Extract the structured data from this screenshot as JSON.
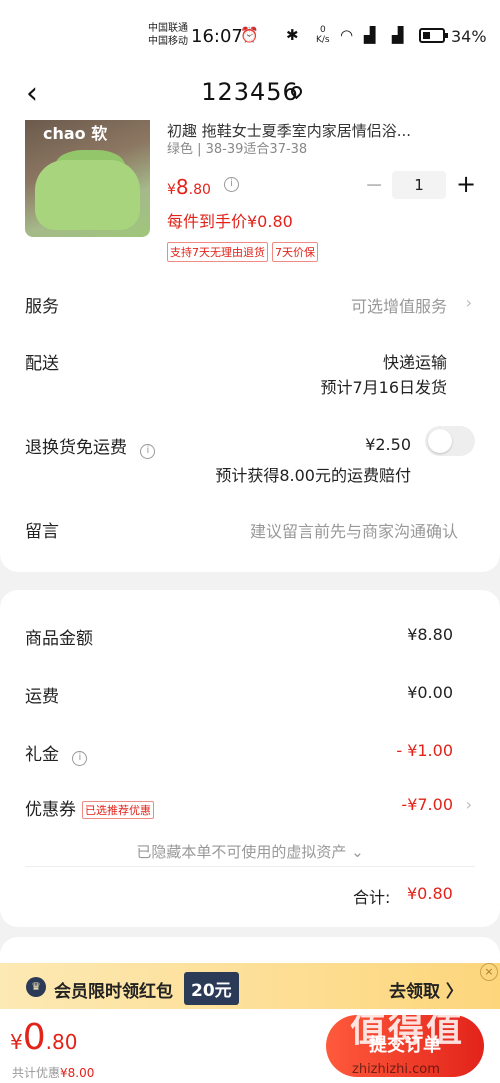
{
  "status": {
    "carrier1": "中国联通",
    "carrier2": "中国移动",
    "time": "16:07",
    "speed_value": "0",
    "speed_unit": "K/s",
    "battery": "34%"
  },
  "nav": {
    "title": "123456"
  },
  "product": {
    "title": "初趣 拖鞋女士夏季室内家居情侣浴...",
    "spec": "绿色 | 38-39适合37-38",
    "price_cur": "¥",
    "price_int": "8",
    "price_dec": ".80",
    "quantity": "1",
    "per_item_price": "每件到手价¥0.80",
    "tags": [
      "支持7天无理由退货",
      "7天价保"
    ],
    "brand_text": "chao 软"
  },
  "rows": {
    "service_label": "服务",
    "service_value": "可选增值服务",
    "delivery_label": "配送",
    "delivery_method": "快递运输",
    "delivery_eta": "预计7月16日发货",
    "return_label": "退换货免运费",
    "return_price": "¥2.50",
    "return_note": "预计获得8.00元的运费赔付",
    "message_label": "留言",
    "message_placeholder": "建议留言前先与商家沟通确认"
  },
  "summary": {
    "goods_label": "商品金额",
    "goods_value": "¥8.80",
    "shipping_label": "运费",
    "shipping_value": "¥0.00",
    "gift_label": "礼金",
    "gift_value": "- ¥1.00",
    "coupon_label": "优惠券",
    "coupon_tag": "已选推荐优惠",
    "coupon_value": "-¥7.00",
    "hidden_note": "已隐藏本单不可使用的虚拟资产 ⌄",
    "total_label": "合计:",
    "total_value": "¥0.80"
  },
  "promo": {
    "text": "会员限时领红包",
    "amount": "20元",
    "action": "去领取 〉",
    "close": "×"
  },
  "bottom": {
    "cur": "¥",
    "int": "0",
    "dec": ".80",
    "discount_prefix": "共计优惠",
    "discount_value": "¥8.00",
    "submit": "提交订单"
  },
  "watermark": {
    "main": "值得值",
    "sub": "zhizhizhi.com"
  },
  "colors": {
    "accent_red": "#e2231a",
    "promo_bg": "#fdd67c",
    "promo_dark": "#2b3a57"
  }
}
